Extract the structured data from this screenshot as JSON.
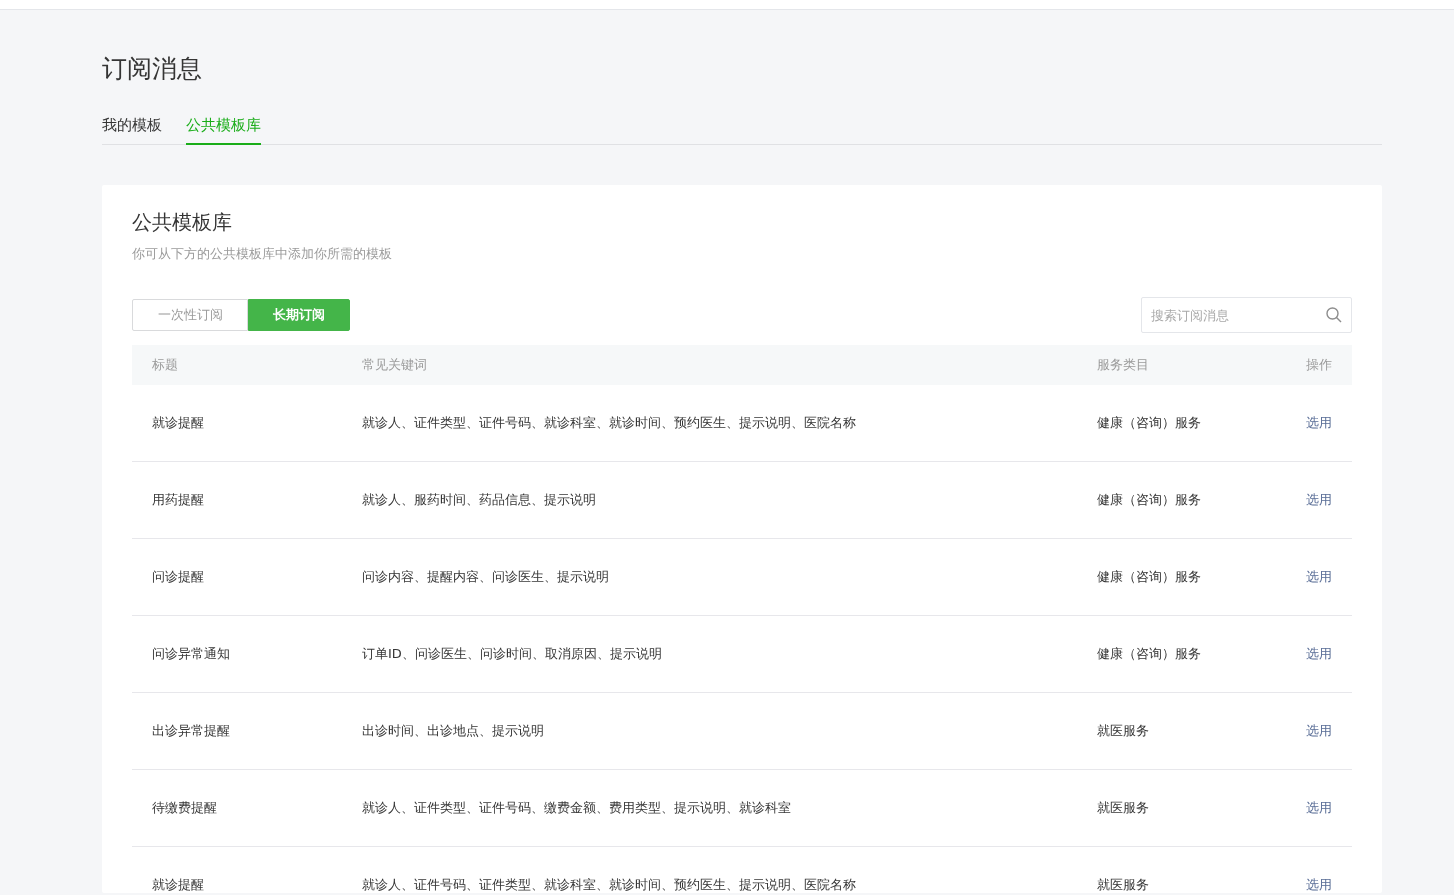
{
  "page_title": "订阅消息",
  "tabs": [
    {
      "label": "我的模板",
      "selected": false
    },
    {
      "label": "公共模板库",
      "selected": true
    }
  ],
  "card": {
    "title": "公共模板库",
    "description": "你可从下方的公共模板库中添加你所需的模板"
  },
  "subscription_types": [
    {
      "label": "一次性订阅",
      "selected": false
    },
    {
      "label": "长期订阅",
      "selected": true
    }
  ],
  "search": {
    "placeholder": "搜索订阅消息"
  },
  "table": {
    "columns": [
      "标题",
      "常见关键词",
      "服务类目",
      "操作"
    ],
    "rows": [
      {
        "title": "就诊提醒",
        "keywords": "就诊人、证件类型、证件号码、就诊科室、就诊时间、预约医生、提示说明、医院名称",
        "category": "健康（咨询）服务",
        "action": "选用"
      },
      {
        "title": "用药提醒",
        "keywords": "就诊人、服药时间、药品信息、提示说明",
        "category": "健康（咨询）服务",
        "action": "选用"
      },
      {
        "title": "问诊提醒",
        "keywords": "问诊内容、提醒内容、问诊医生、提示说明",
        "category": "健康（咨询）服务",
        "action": "选用"
      },
      {
        "title": "问诊异常通知",
        "keywords": "订单ID、问诊医生、问诊时间、取消原因、提示说明",
        "category": "健康（咨询）服务",
        "action": "选用"
      },
      {
        "title": "出诊异常提醒",
        "keywords": "出诊时间、出诊地点、提示说明",
        "category": "就医服务",
        "action": "选用"
      },
      {
        "title": "待缴费提醒",
        "keywords": "就诊人、证件类型、证件号码、缴费金额、费用类型、提示说明、就诊科室",
        "category": "就医服务",
        "action": "选用"
      },
      {
        "title": "就诊提醒",
        "keywords": "就诊人、证件号码、证件类型、就诊科室、就诊时间、预约医生、提示说明、医院名称",
        "category": "就医服务",
        "action": "选用"
      }
    ]
  }
}
